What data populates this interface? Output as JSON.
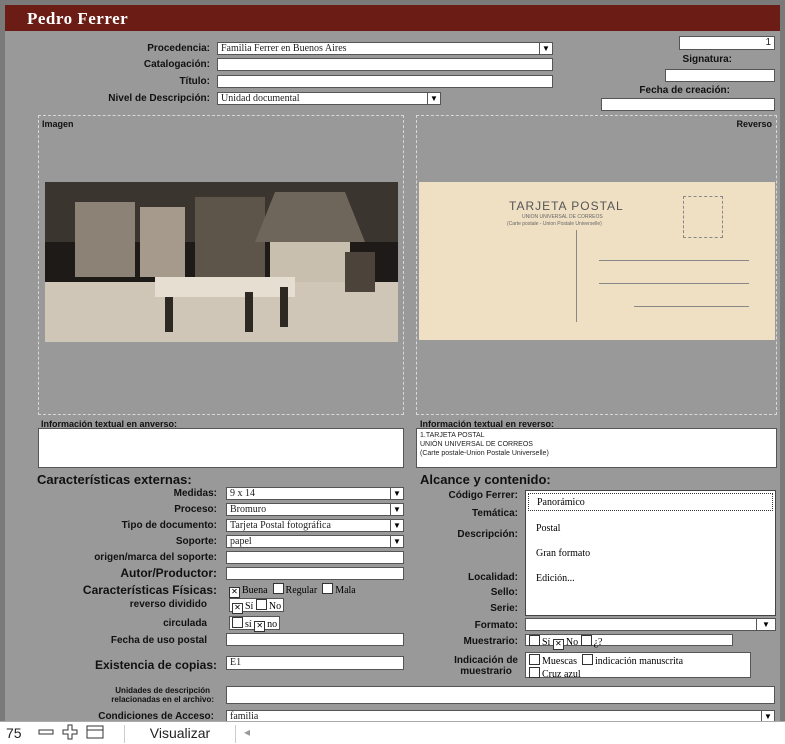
{
  "header": {
    "title": "Pedro Ferrer"
  },
  "top": {
    "procedencia_label": "Procedencia:",
    "procedencia_value": "Familia Ferrer en Buenos Aires",
    "catalogacion_label": "Catalogación:",
    "titulo_label": "Título:",
    "nivel_label": "Nivel de Descripción:",
    "nivel_value": "Unidad documental",
    "record_number": "1",
    "signatura_label": "Signatura:",
    "fecha_creacion_label": "Fecha de creación:"
  },
  "images": {
    "imagen_label": "Imagen",
    "reverso_label": "Reverso",
    "card_title": "TARJETA POSTAL",
    "card_sub1": "UNION UNIVERSAL DE CORREOS",
    "card_sub2": "(Carte postale - Union Postale Universelle)"
  },
  "textual": {
    "anverso_label": "Información textual en anverso:",
    "reverso_label": "Información textual en reverso:",
    "reverso_lines": [
      "1.TARJETA POSTAL",
      "UNIÓN UNIVERSAL DE CORREOS",
      "(Carte postale-Union Postale Universelle)"
    ]
  },
  "externas": {
    "section_title": "Características externas:",
    "medidas_label": "Medidas:",
    "medidas_value": "9 x 14",
    "proceso_label": "Proceso:",
    "proceso_value": "Bromuro",
    "tipo_label": "Tipo de documento:",
    "tipo_value": "Tarjeta Postal fotográfica",
    "soporte_label": "Soporte:",
    "soporte_value": "papel",
    "origen_label": "origen/marca del soporte:",
    "autor_label": "Autor/Productor:",
    "fisicas_label": "Características Físicas:",
    "fisicas_options": [
      "Buena",
      "Regular",
      "Mala"
    ],
    "reverso_dividido_label": "reverso dividido",
    "reverso_dividido_options": [
      "Sí",
      "No"
    ],
    "circulada_label": "circulada",
    "circulada_options": [
      "sí",
      "no"
    ],
    "fecha_uso_label": "Fecha de uso postal",
    "existencia_label": "Existencia de copias:",
    "existencia_value": "E1",
    "unidades_label1": "Unidades de descripción",
    "unidades_label2": "relacionadas en el archivo:",
    "condiciones_label": "Condiciones de Acceso:",
    "condiciones_value": "familia"
  },
  "alcance": {
    "section_title": "Alcance y contenido:",
    "codigo_label": "Código Ferrer:",
    "tematica_label": "Temática:",
    "descripcion_label": "Descripción:",
    "localidad_label": "Localidad:",
    "sello_label": "Sello:",
    "serie_label": "Serie:",
    "formato_label": "Formato:",
    "formato_options": [
      "Panorámico",
      "Postal",
      "Gran formato",
      "Edición..."
    ],
    "muestrario_label": "Muestrario:",
    "muestrario_options": [
      "Sí",
      "No",
      "¿?"
    ],
    "indicacion_label1": "Indicación de",
    "indicacion_label2": "muestrario",
    "indicacion_options": [
      "Muescas",
      "indicación manuscrita",
      "Cruz azul"
    ]
  },
  "footer": {
    "zoom": "75",
    "mode": "Visualizar"
  },
  "colors": {
    "header": "#6b1c14",
    "form_bg": "#999999"
  }
}
